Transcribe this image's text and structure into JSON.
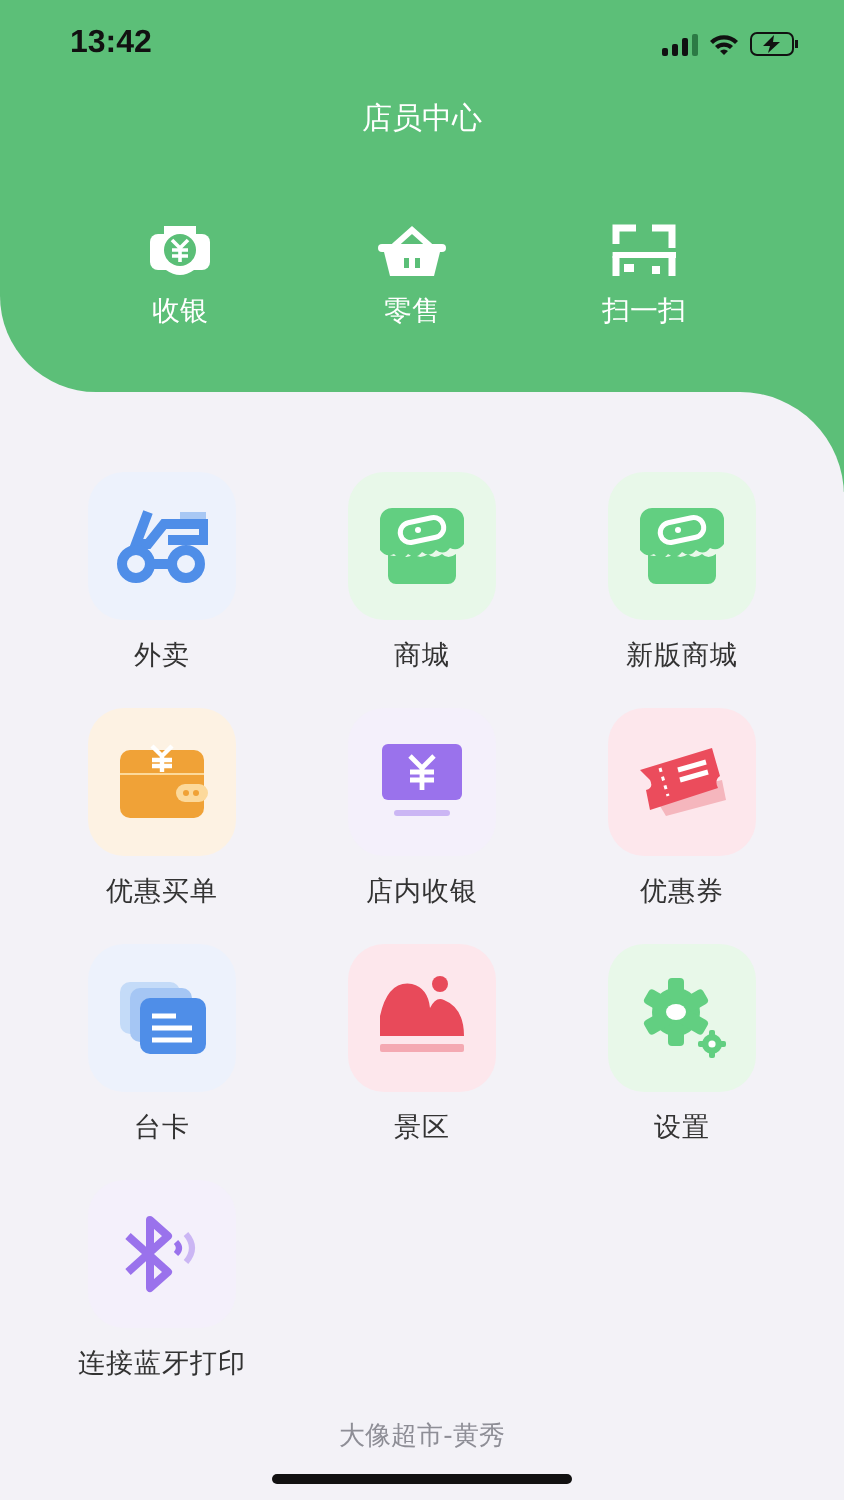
{
  "status_bar": {
    "time": "13:42"
  },
  "header": {
    "title": "店员中心"
  },
  "quick_actions": [
    {
      "label": "收银"
    },
    {
      "label": "零售"
    },
    {
      "label": "扫一扫"
    }
  ],
  "menu_items": [
    {
      "label": "外卖"
    },
    {
      "label": "商城"
    },
    {
      "label": "新版商城"
    },
    {
      "label": "优惠买单"
    },
    {
      "label": "店内收银"
    },
    {
      "label": "优惠券"
    },
    {
      "label": "台卡"
    },
    {
      "label": "景区"
    },
    {
      "label": "设置"
    },
    {
      "label": "连接蓝牙打印"
    }
  ],
  "footer": {
    "text": "大像超市-黄秀"
  }
}
